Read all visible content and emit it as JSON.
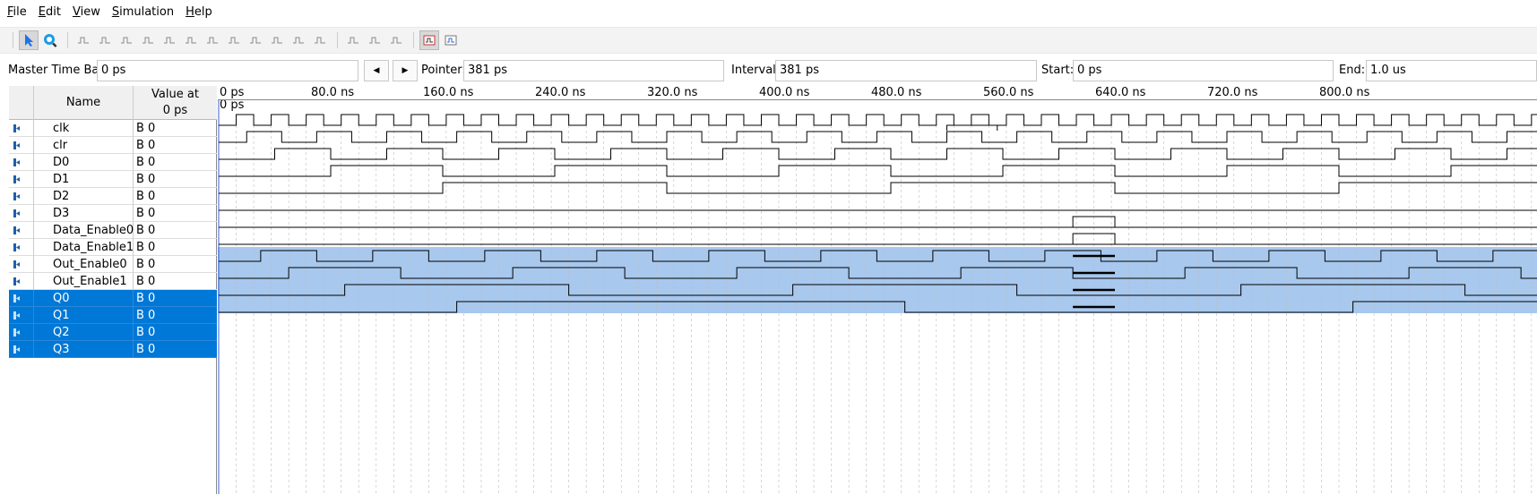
{
  "menu": [
    {
      "key": "F",
      "rest": "ile"
    },
    {
      "key": "E",
      "rest": "dit"
    },
    {
      "key": "V",
      "rest": "iew"
    },
    {
      "key": "S",
      "rest": "imulation"
    },
    {
      "key": "H",
      "rest": "elp"
    }
  ],
  "toolbar": {
    "icons": [
      "selection-tool-icon",
      "zoom-tool-icon",
      "uninitialized-icon",
      "forcing-low-icon",
      "forcing-high-icon",
      "high-impedance-icon",
      "weak-low-icon",
      "weak-high-icon",
      "dont-care-icon",
      "invert-icon",
      "count-value-icon",
      "clock-icon",
      "arbitrary-value-icon",
      "random-value-icon",
      "snap-to-transition-icon",
      "find-icon",
      "replace-icon",
      "run-functional-simulation-icon",
      "run-timing-simulation-icon"
    ]
  },
  "timebar": {
    "master_label": "Master Time Bar:",
    "master_value": "0 ps",
    "pointer_label": "Pointer:",
    "pointer_value": "381 ps",
    "interval_label": "Interval:",
    "interval_value": "381 ps",
    "start_label": "Start:",
    "start_value": "0 ps",
    "end_label": "End:",
    "end_value": "1.0 us"
  },
  "table": {
    "name_header": "Name",
    "value_header_1": "Value at",
    "value_header_2": "0 ps",
    "signals": [
      {
        "name": "clk",
        "value": "B 0",
        "type": "input"
      },
      {
        "name": "clr",
        "value": "B 0",
        "type": "input"
      },
      {
        "name": "D0",
        "value": "B 0",
        "type": "input"
      },
      {
        "name": "D1",
        "value": "B 0",
        "type": "input"
      },
      {
        "name": "D2",
        "value": "B 0",
        "type": "input"
      },
      {
        "name": "D3",
        "value": "B 0",
        "type": "input"
      },
      {
        "name": "Data_Enable0",
        "value": "B 0",
        "type": "input"
      },
      {
        "name": "Data_Enable1",
        "value": "B 0",
        "type": "input"
      },
      {
        "name": "Out_Enable0",
        "value": "B 0",
        "type": "input"
      },
      {
        "name": "Out_Enable1",
        "value": "B 0",
        "type": "input"
      },
      {
        "name": "Q0",
        "value": "B 0",
        "type": "output"
      },
      {
        "name": "Q1",
        "value": "B 0",
        "type": "output"
      },
      {
        "name": "Q2",
        "value": "B 0",
        "type": "output"
      },
      {
        "name": "Q3",
        "value": "B 0",
        "type": "output"
      }
    ]
  },
  "timeline": {
    "ticks": [
      "0 ps",
      "80.0 ns",
      "160.0 ns",
      "240.0 ns",
      "320.0 ns",
      "400.0 ns",
      "480.0 ns",
      "560.0 ns",
      "640.0 ns",
      "720.0 ns",
      "800.0 ns"
    ],
    "cursor_label": "0 ps"
  },
  "colors": {
    "selection": "#0078d7",
    "wave_highlight": "#a8c8ee",
    "wave_line": "#000000"
  }
}
